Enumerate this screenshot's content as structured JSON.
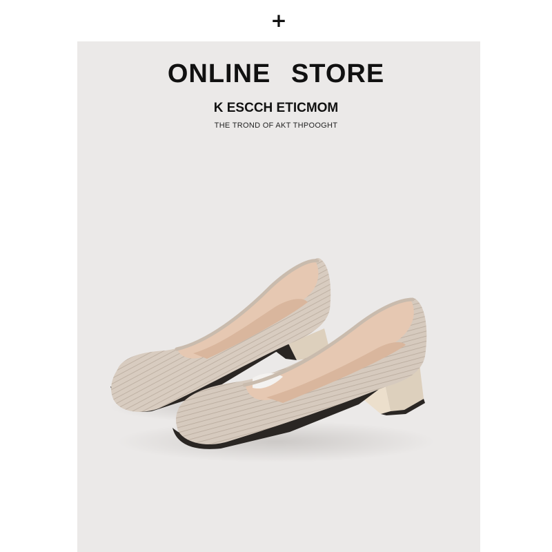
{
  "header": {
    "plus_icon": "plus-icon",
    "plus_glyph": "+"
  },
  "banner": {
    "title": "ONLINE STORE",
    "subtitle": "K ESCCH ETICMOM",
    "tagline": "THE TROND OF AKT THPOOGHT"
  },
  "product": {
    "image": "knit-square-toe-block-heel-pumps",
    "color_upper": "#d8ccc0",
    "color_lining": "#e6c8b2",
    "color_heel": "#ddd0bd",
    "color_panel": "#ebe9e8"
  }
}
